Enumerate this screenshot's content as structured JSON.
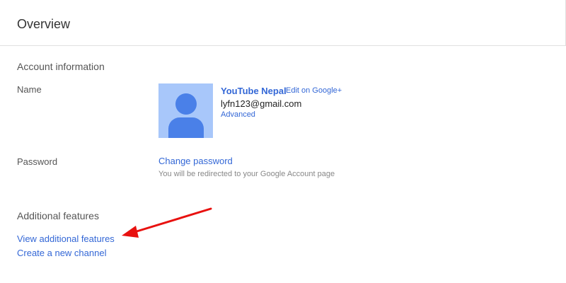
{
  "header": {
    "title": "Overview"
  },
  "account_information": {
    "heading": "Account information",
    "name_label": "Name",
    "channel_name": "YouTube Nepal",
    "edit_link": "Edit on Google+",
    "email": "lyfn123@gmail.com",
    "advanced_link": "Advanced",
    "password_label": "Password",
    "change_password_link": "Change password",
    "redirect_note": "You will be redirected to your Google Account page"
  },
  "additional_features": {
    "heading": "Additional features",
    "view_features_link": "View additional features",
    "create_channel_link": "Create a new channel"
  },
  "colors": {
    "link": "#3367d6",
    "annotation_arrow": "#e8110f",
    "avatar_bg": "#a8c7fa",
    "avatar_fg": "#4a80e8"
  }
}
